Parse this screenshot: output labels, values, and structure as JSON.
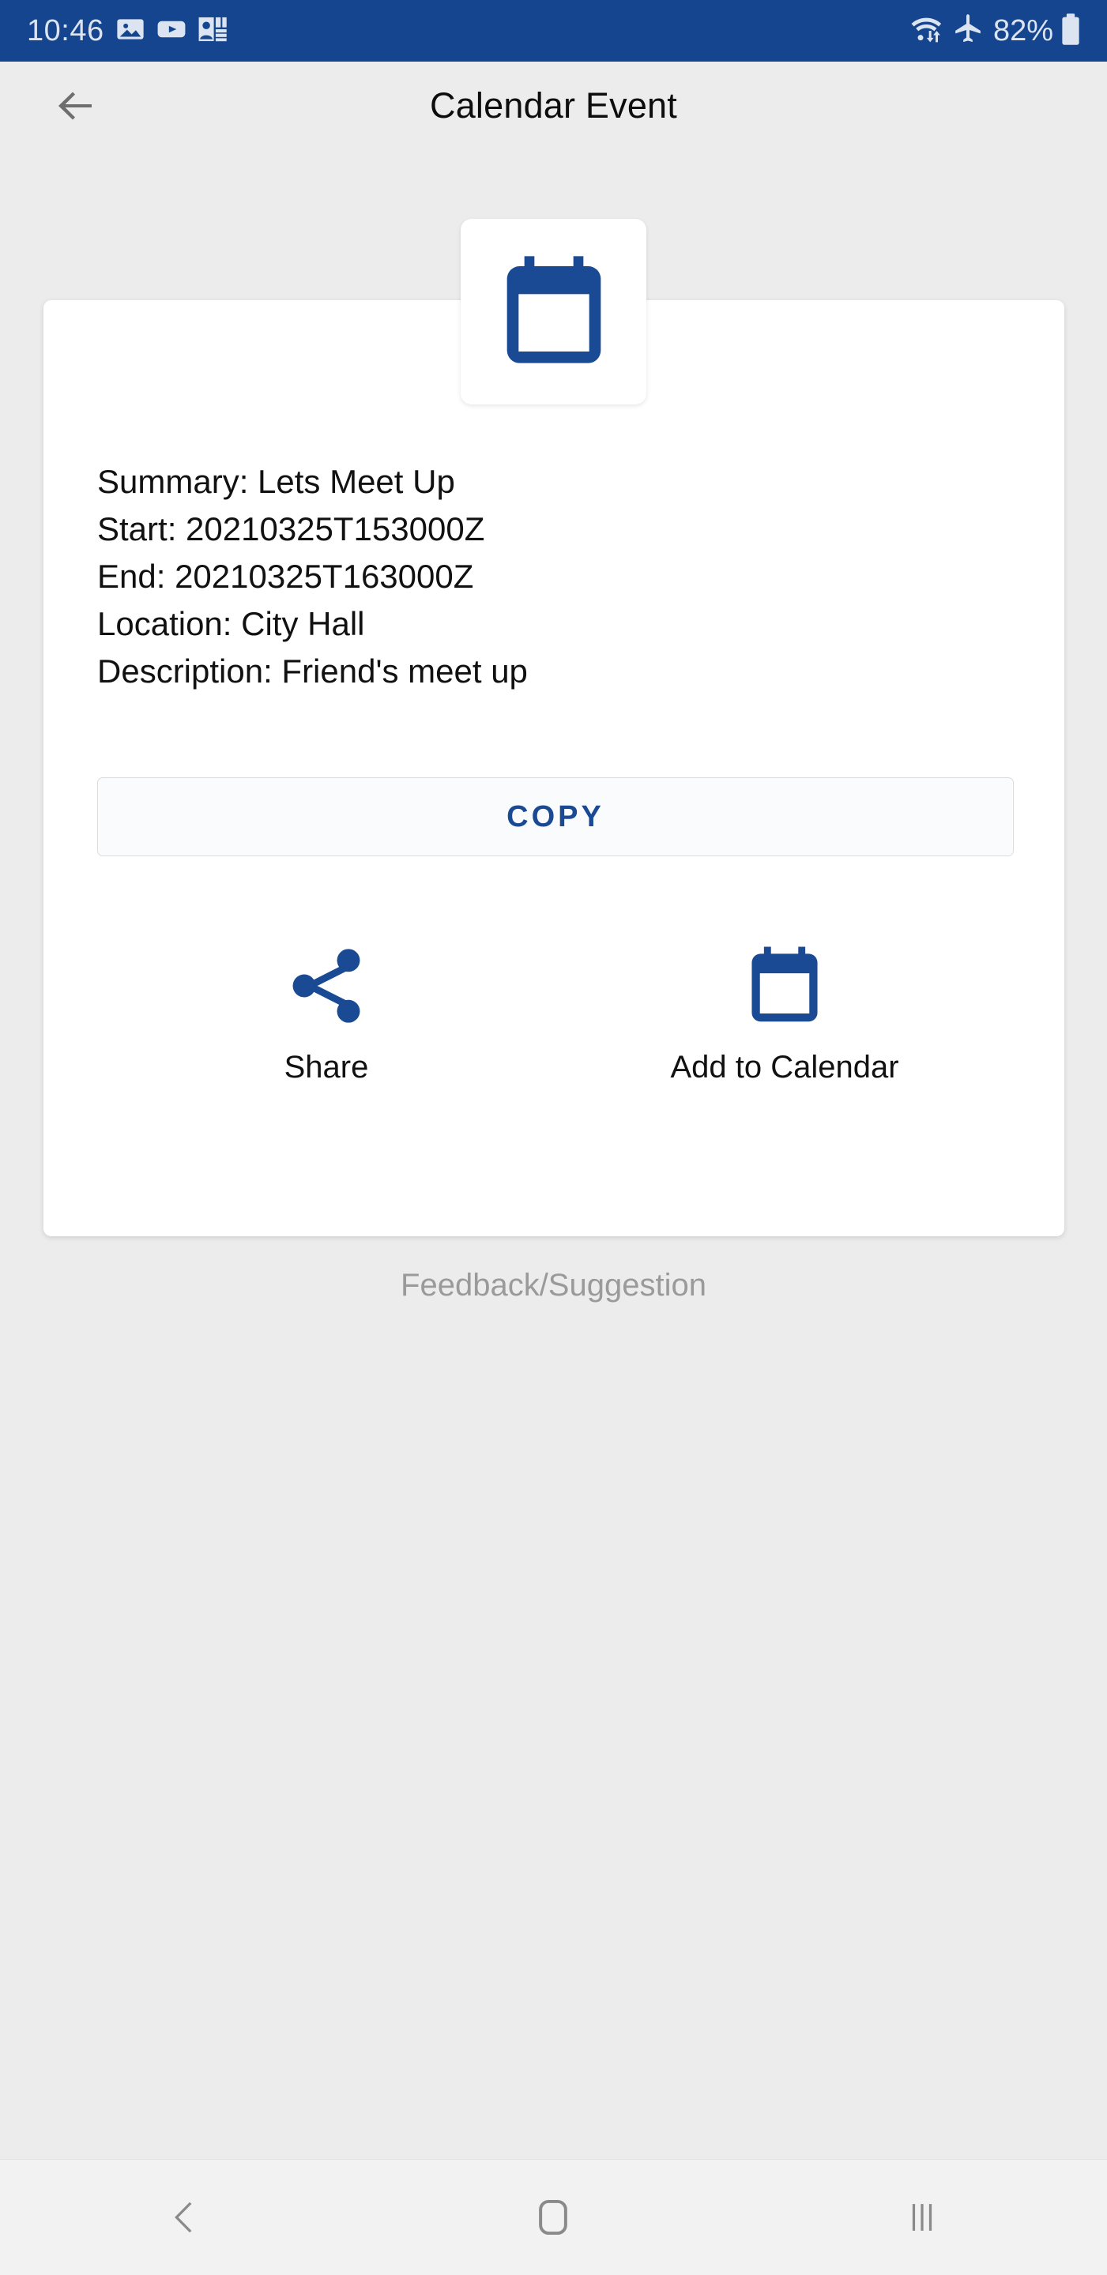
{
  "status_bar": {
    "clock": "10:46",
    "battery_percent": "82%",
    "background_color": "#16458F",
    "foreground_color": "#DBE4F0",
    "left_icons": [
      "gallery-icon",
      "video-player-icon",
      "contact-card-icon"
    ],
    "right_icons": [
      "wifi-transfer-icon",
      "airplane-mode-icon",
      "battery-icon"
    ]
  },
  "header": {
    "title": "Calendar Event",
    "back_icon": "arrow-left-icon"
  },
  "brand": {
    "accent_color": "#1A4A93",
    "page_background": "#ECECEC",
    "card_background": "#FFFFFF"
  },
  "card": {
    "header_icon": "calendar-icon",
    "fields": [
      "Summary: Lets Meet Up",
      "Start: 20210325T153000Z",
      "End: 20210325T163000Z",
      "Location: City Hall",
      "Description: Friend's meet up"
    ],
    "copy_button_label": "COPY",
    "actions": [
      {
        "label": "Share",
        "icon": "share-icon"
      },
      {
        "label": "Add to Calendar",
        "icon": "calendar-icon"
      }
    ]
  },
  "feedback": {
    "label": "Feedback/Suggestion"
  },
  "nav_bar": {
    "buttons": [
      {
        "name": "back",
        "icon": "chevron-left-icon"
      },
      {
        "name": "home",
        "icon": "home-square-icon"
      },
      {
        "name": "recents",
        "icon": "recents-bars-icon"
      }
    ]
  }
}
